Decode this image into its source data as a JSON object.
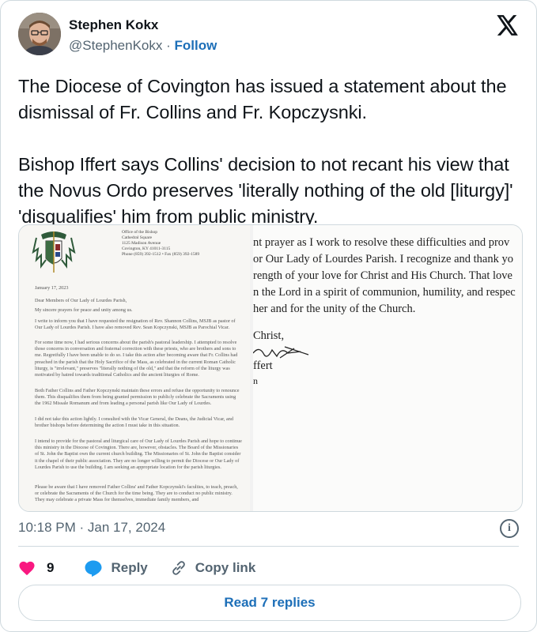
{
  "user": {
    "name": "Stephen Kokx",
    "handle": "@StephenKokx",
    "separator": "·",
    "follow_label": "Follow"
  },
  "tweet": {
    "text": "The Diocese of Covington has issued a statement about the dismissal of Fr. Collins and Fr. Kopczysnki.\n\nBishop Iffert says Collins' decision to not recant his view that the Novus Ordo preserves 'literally nothing of the old [liturgy]' 'disqualifies' him from public ministry.",
    "timestamp": "10:18 PM · Jan 17, 2024"
  },
  "document_left": {
    "header_lines": [
      "Office of the Bishop",
      "Cathedral Square",
      "1125 Madison Avenue",
      "Covington, KY 41011-3115",
      "Phone (859) 392-1512 • Fax (859) 392-1589"
    ],
    "date": "January 17, 2023",
    "salutation": "Dear Members of Our Lady of Lourdes Parish,",
    "greeting": "My sincere prayers for peace and unity among us.",
    "paragraphs": [
      "I write to inform you that I have requested the resignation of Rev. Shannon Collins, MSJB as pastor of Our Lady of Lourdes Parish. I have also removed Rev. Sean Kopczynski, MSJB as Parochial Vicar.",
      "For some time now, I had serious concerns about the parish's pastoral leadership. I attempted to resolve those concerns in conversation and fraternal correction with these priests, who are brothers and sons to me. Regretfully I have been unable to do so. I take this action after becoming aware that Fr. Collins had preached in the parish that the Holy Sacrifice of the Mass, as celebrated in the current Roman Catholic liturgy, is \"irrelevant,\" preserves \"literally nothing of the old,\" and that the reform of the liturgy was motivated by hatred towards traditional Catholics and the ancient liturgies of Rome.",
      "Both Father Collins and Father Kopczynski maintain these errors and refuse the opportunity to renounce them. This disqualifies them from being granted permission to publicly celebrate the Sacraments using the 1962 Missale Romanum and from leading a personal parish like Our Lady of Lourdes.",
      "I did not take this action lightly. I consulted with the Vicar General, the Deans, the Judicial Vicar, and brother bishops before determining the action I must take in this situation.",
      "I intend to provide for the pastoral and liturgical care of Our Lady of Lourdes Parish and hope to continue this ministry in the Diocese of Covington. There are, however, obstacles. The Board of the Missionaries of St. John the Baptist own the current church building. The Missionaries of St. John the Baptist consider it the chapel of their public association. They are no longer willing to permit the Diocese or Our Lady of Lourdes Parish to use the building. I am seeking an appropriate location for the parish liturgies.",
      "Please be aware that I have removed Father Collins' and Father Kopczynski's faculties, to teach, preach, or celebrate the Sacraments of the Church for the time being. They are to conduct no public ministry. They may celebrate a private Mass for themselves, immediate family members, and"
    ]
  },
  "document_right": {
    "lines": [
      "nt prayer as I work to resolve these difficulties and prov",
      "or Our Lady of Lourdes Parish. I recognize and thank yo",
      "rength of your love for Christ and His Church. That love",
      "n the Lord in a spirit of communion, humility, and respec",
      "her and for the unity of the Church."
    ],
    "closing": "Christ,",
    "signature_name": "ffert",
    "tail": "n"
  },
  "actions": {
    "likes_count": "9",
    "reply_label": "Reply",
    "copy_label": "Copy link"
  },
  "read_replies_label": "Read 7 replies",
  "colors": {
    "accent": "#1d9bf0",
    "like": "#f91880",
    "muted": "#536471"
  }
}
